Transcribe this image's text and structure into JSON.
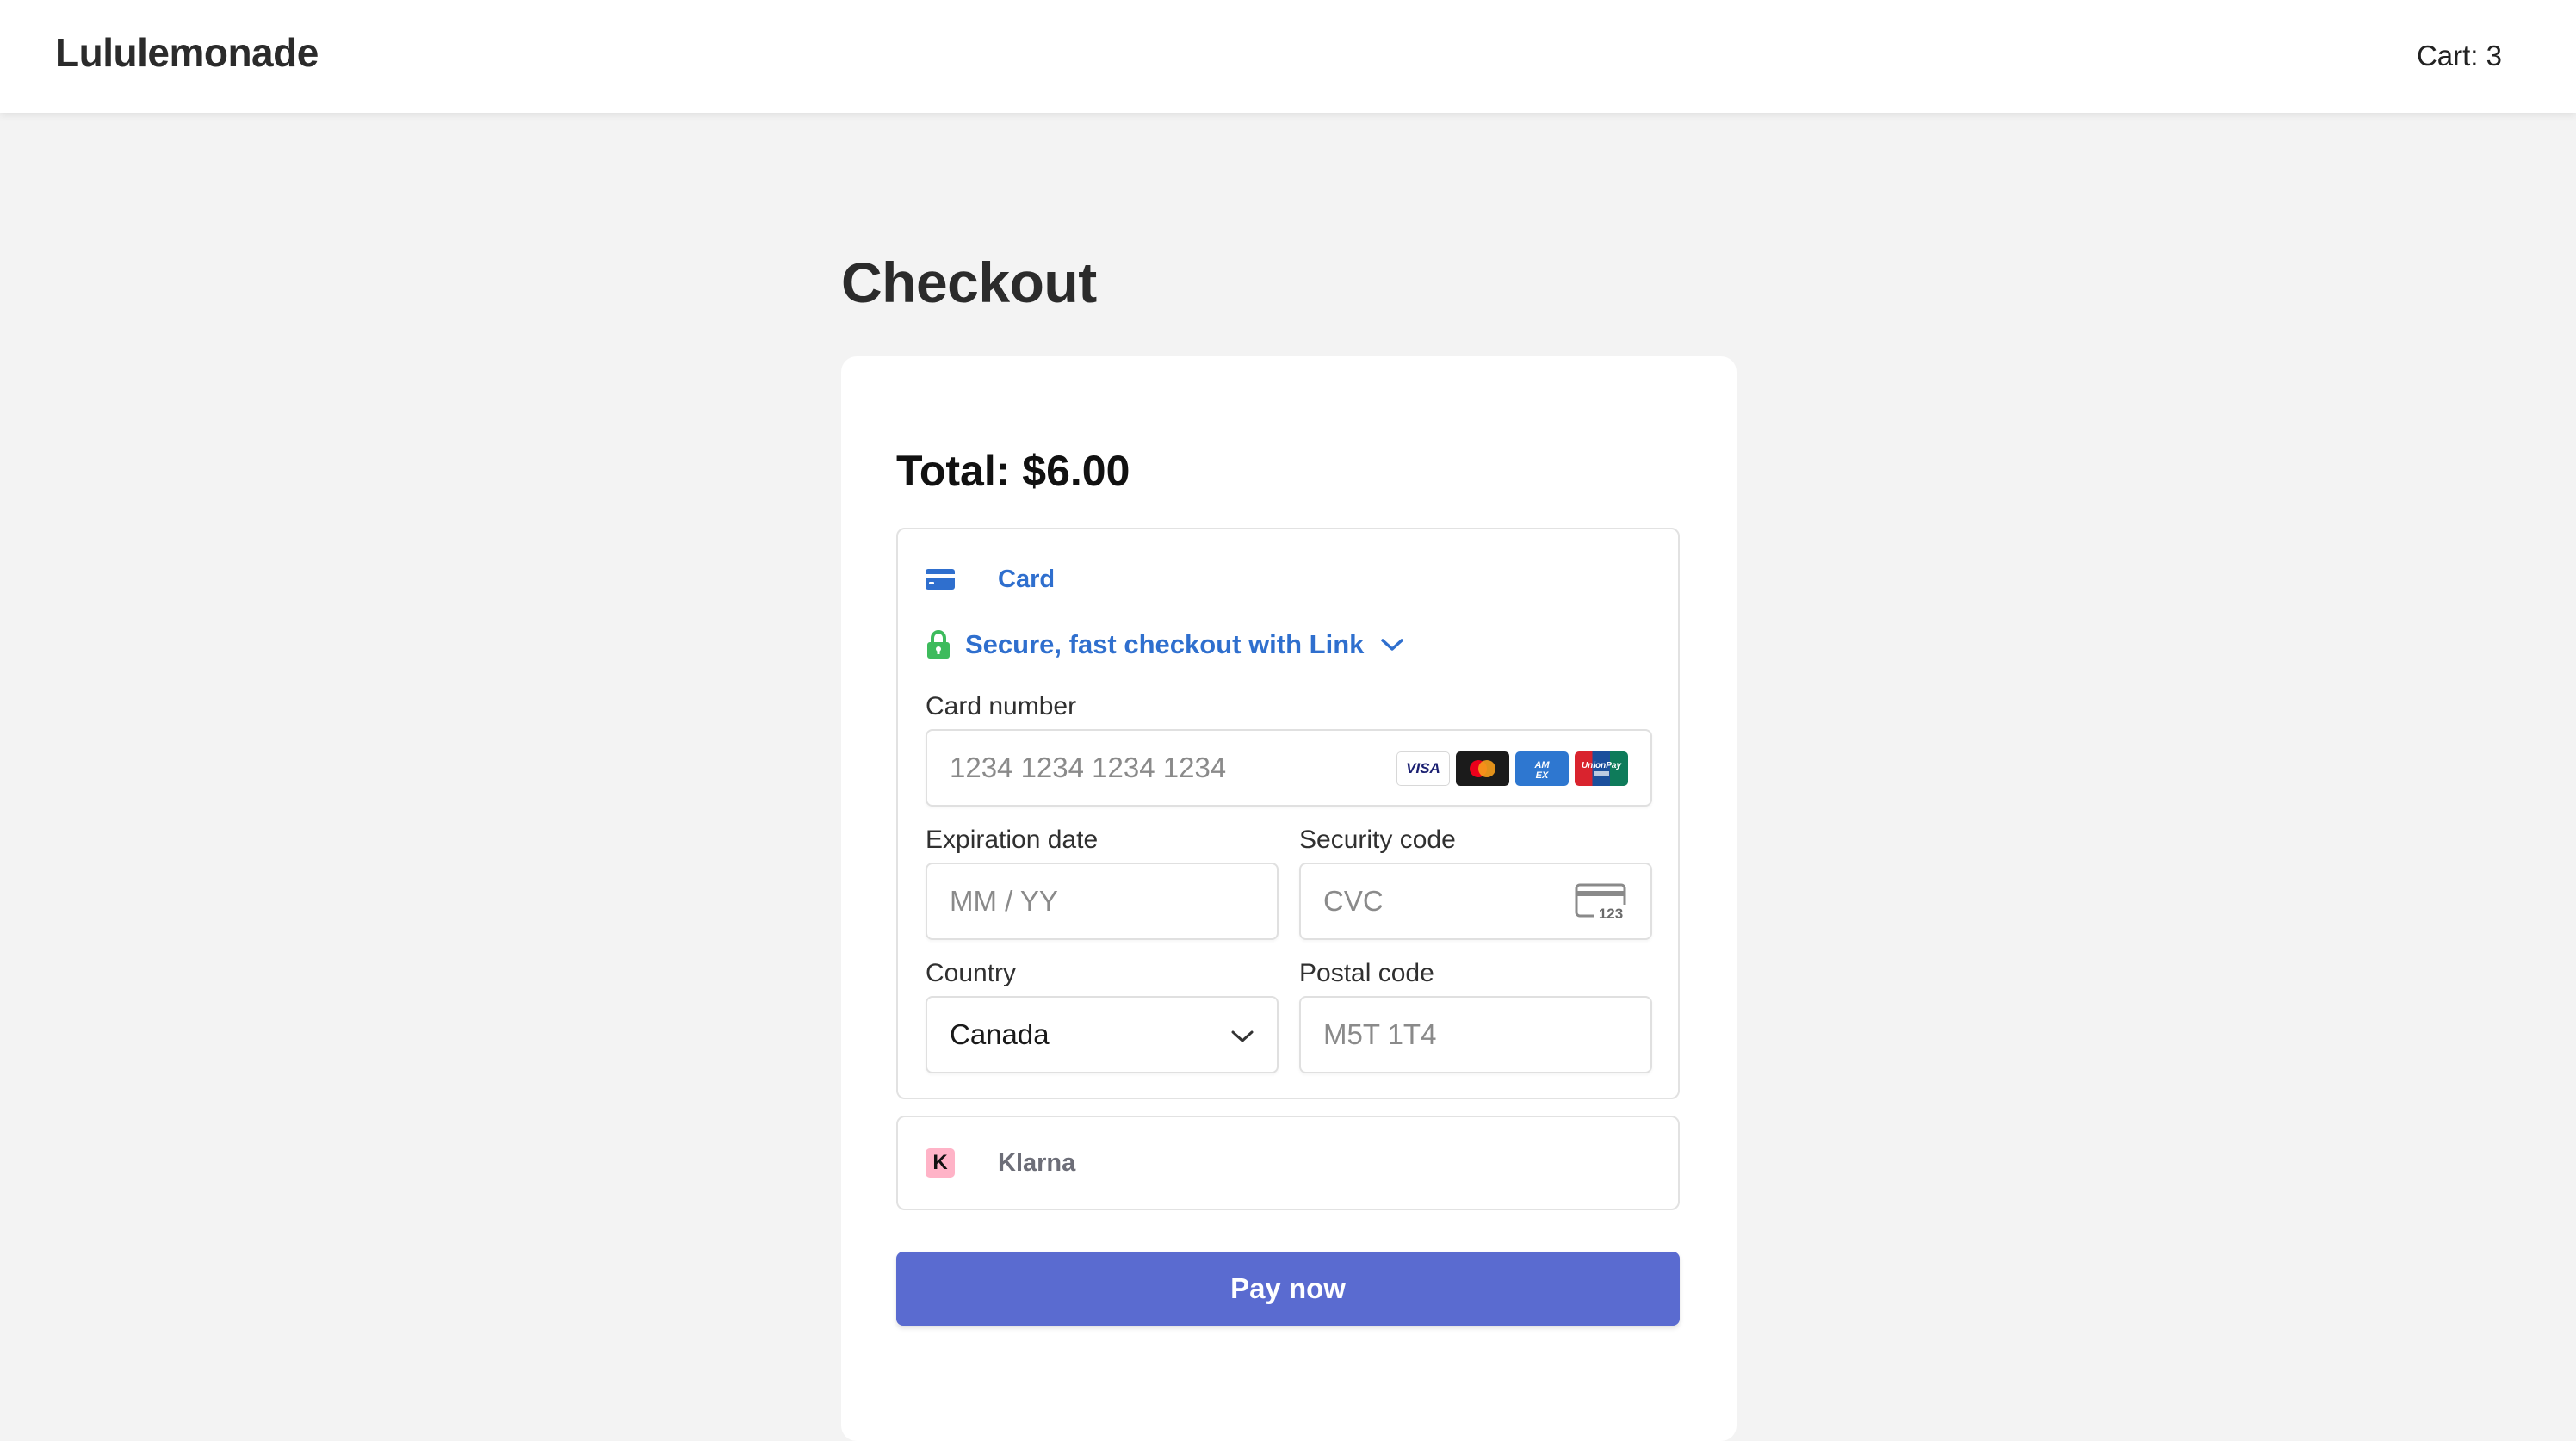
{
  "header": {
    "brand": "Lululemonade",
    "cart_label": "Cart: 3"
  },
  "page": {
    "title": "Checkout"
  },
  "checkout": {
    "total_label": "Total: $6.00",
    "card_tab_label": "Card",
    "link_text": "Secure, fast checkout with Link",
    "card_number": {
      "label": "Card number",
      "placeholder": "1234 1234 1234 1234",
      "brands": [
        "VISA",
        "Mastercard",
        "AMEX",
        "UnionPay"
      ]
    },
    "expiration": {
      "label": "Expiration date",
      "placeholder": "MM / YY"
    },
    "security_code": {
      "label": "Security code",
      "placeholder": "CVC",
      "icon_text": "123"
    },
    "country": {
      "label": "Country",
      "value": "Canada"
    },
    "postal_code": {
      "label": "Postal code",
      "placeholder": "M5T 1T4"
    },
    "klarna_label": "Klarna",
    "klarna_logo_text": "K",
    "pay_button_label": "Pay now"
  },
  "colors": {
    "accent_blue": "#2f6fce",
    "pay_button": "#5a6bd0",
    "lock_green": "#3dbb5c",
    "klarna_pink": "#ffb3c7",
    "page_background": "#f3f3f3"
  },
  "icons": {
    "card_tab": "credit-card-icon",
    "link": "lock-icon",
    "link_expand": "chevron-down-icon",
    "cvc": "cvc-card-icon",
    "country_select": "chevron-down-icon"
  }
}
